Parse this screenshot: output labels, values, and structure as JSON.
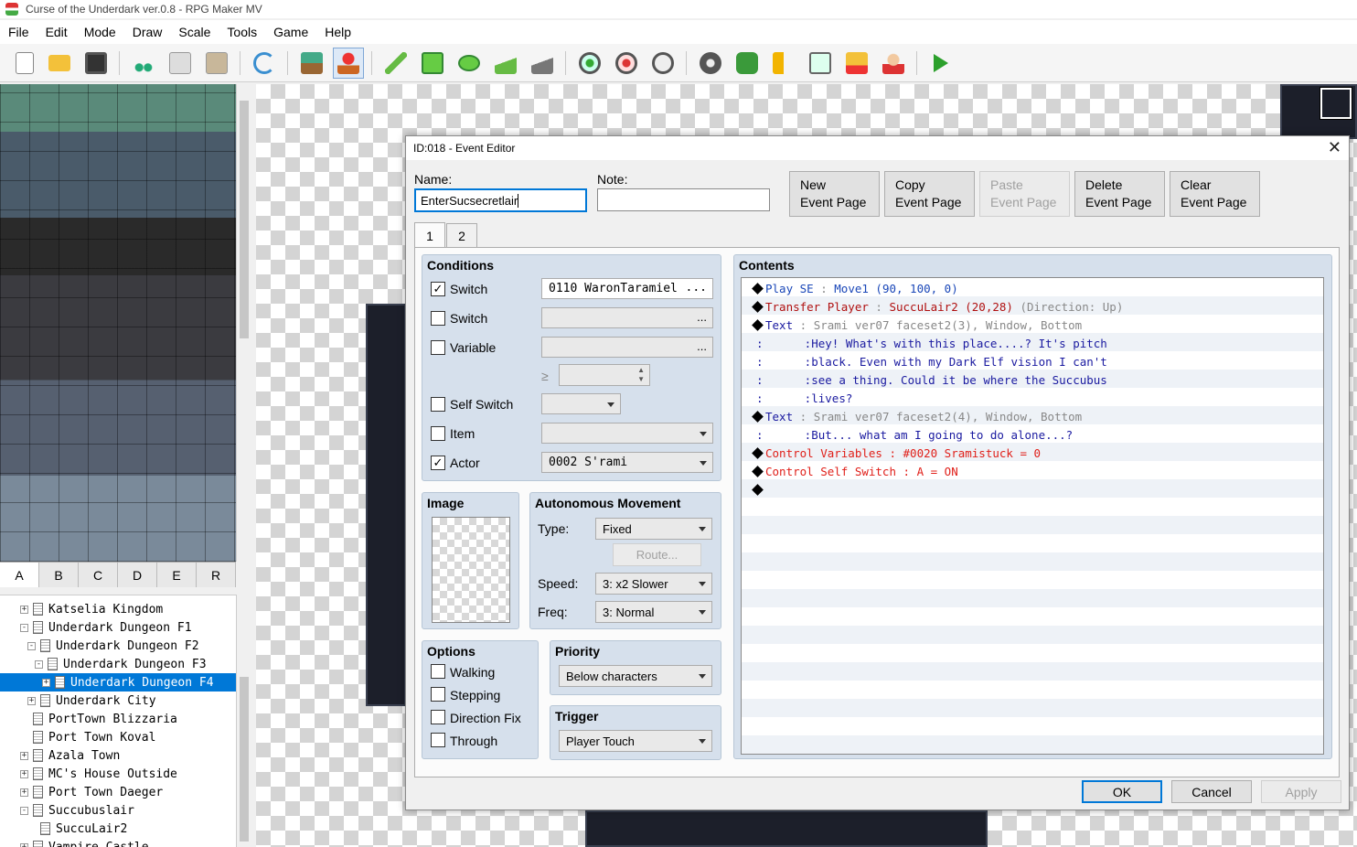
{
  "window": {
    "title": "Curse of the Underdark ver.0.8 - RPG Maker MV"
  },
  "menu": [
    "File",
    "Edit",
    "Mode",
    "Draw",
    "Scale",
    "Tools",
    "Game",
    "Help"
  ],
  "toolbar": {
    "icons": [
      "new-project-icon",
      "open-project-icon",
      "save-project-icon",
      "cut-icon",
      "copy-icon",
      "paste-icon",
      "undo-icon",
      "map-mode-icon",
      "event-mode-icon",
      "pencil-icon",
      "rectangle-icon",
      "ellipse-icon",
      "fill-icon",
      "shadow-pen-icon",
      "zoom-in-icon",
      "zoom-out-icon",
      "actual-size-icon",
      "database-icon",
      "plugin-manager-icon",
      "sound-test-icon",
      "event-searcher-icon",
      "resource-manager-icon",
      "character-generator-icon",
      "playtest-icon"
    ]
  },
  "tile_tabs": [
    "A",
    "B",
    "C",
    "D",
    "E",
    "R"
  ],
  "map_tree": [
    {
      "label": "Katselia Kingdom",
      "indent": 0,
      "exp": "+"
    },
    {
      "label": "Underdark Dungeon F1",
      "indent": 0,
      "exp": "-"
    },
    {
      "label": "Underdark Dungeon F2",
      "indent": 1,
      "exp": "-"
    },
    {
      "label": "Underdark Dungeon F3",
      "indent": 2,
      "exp": "-"
    },
    {
      "label": "Underdark Dungeon F4",
      "indent": 3,
      "exp": "+",
      "selected": true
    },
    {
      "label": "Underdark City",
      "indent": 1,
      "exp": "+"
    },
    {
      "label": "PortTown Blizzaria",
      "indent": 0,
      "exp": ""
    },
    {
      "label": "Port Town Koval",
      "indent": 0,
      "exp": ""
    },
    {
      "label": "Azala Town",
      "indent": 0,
      "exp": "+"
    },
    {
      "label": "MC's House Outside",
      "indent": 0,
      "exp": "+"
    },
    {
      "label": "Port Town Daeger",
      "indent": 0,
      "exp": "+"
    },
    {
      "label": "Succubuslair",
      "indent": 0,
      "exp": "-"
    },
    {
      "label": "SuccuLair2",
      "indent": 1,
      "exp": ""
    },
    {
      "label": "Vampire Castle",
      "indent": 0,
      "exp": "+"
    }
  ],
  "dialog": {
    "title": "ID:018 - Event Editor",
    "name_label": "Name:",
    "name_value": "EnterSucsecretlair",
    "note_label": "Note:",
    "note_value": "",
    "buttons": {
      "new_page": [
        "New",
        "Event Page"
      ],
      "copy_page": [
        "Copy",
        "Event Page"
      ],
      "paste_page": [
        "Paste",
        "Event Page"
      ],
      "delete_page": [
        "Delete",
        "Event Page"
      ],
      "clear_page": [
        "Clear",
        "Event Page"
      ]
    },
    "tabs": [
      "1",
      "2"
    ],
    "conditions": {
      "title": "Conditions",
      "switch1": {
        "label": "Switch",
        "checked": true,
        "value": "0110 WaronTaramiel"
      },
      "switch2": {
        "label": "Switch",
        "checked": false,
        "value": ""
      },
      "variable": {
        "label": "Variable",
        "checked": false,
        "value": ""
      },
      "gte": "≥",
      "self_switch": {
        "label": "Self Switch",
        "checked": false,
        "value": ""
      },
      "item": {
        "label": "Item",
        "checked": false,
        "value": ""
      },
      "actor": {
        "label": "Actor",
        "checked": true,
        "value": "0002 S'rami"
      },
      "more": "..."
    },
    "image": {
      "title": "Image"
    },
    "autonomous": {
      "title": "Autonomous Movement",
      "type_label": "Type:",
      "type_value": "Fixed",
      "route_label": "Route...",
      "speed_label": "Speed:",
      "speed_value": "3: x2 Slower",
      "freq_label": "Freq:",
      "freq_value": "3: Normal"
    },
    "options": {
      "title": "Options",
      "walking": "Walking",
      "stepping": "Stepping",
      "direction_fix": "Direction Fix",
      "through": "Through"
    },
    "priority": {
      "title": "Priority",
      "value": "Below characters"
    },
    "trigger": {
      "title": "Trigger",
      "value": "Player Touch"
    },
    "contents": {
      "title": "Contents",
      "lines": [
        {
          "diamond": true,
          "parts": [
            [
              "Play SE",
              "c-blue"
            ],
            [
              " : ",
              "c-grey"
            ],
            [
              "Move1 (90, 100, 0)",
              "c-blue"
            ]
          ]
        },
        {
          "diamond": true,
          "parts": [
            [
              "Transfer Player",
              "c-dred"
            ],
            [
              " : ",
              "c-grey"
            ],
            [
              "SuccuLair2 (20,28)",
              "c-dred"
            ],
            [
              " (Direction: Up)",
              "c-grey"
            ]
          ]
        },
        {
          "diamond": true,
          "parts": [
            [
              "Text",
              "c-navy"
            ],
            [
              " : ",
              "c-grey"
            ],
            [
              "Srami ver07 faceset2(3), Window, Bottom",
              "c-grey"
            ]
          ]
        },
        {
          "diamond": false,
          "parts": [
            [
              ":      :",
              "c-navy"
            ],
            [
              "Hey! What's with this place....? It's pitch",
              "c-navy"
            ]
          ]
        },
        {
          "diamond": false,
          "parts": [
            [
              ":      :",
              "c-navy"
            ],
            [
              "black. Even with my Dark Elf vision I can't",
              "c-navy"
            ]
          ]
        },
        {
          "diamond": false,
          "parts": [
            [
              ":      :",
              "c-navy"
            ],
            [
              "see a thing. Could it be where the Succubus",
              "c-navy"
            ]
          ]
        },
        {
          "diamond": false,
          "parts": [
            [
              ":      :",
              "c-navy"
            ],
            [
              "lives?",
              "c-navy"
            ]
          ]
        },
        {
          "diamond": true,
          "parts": [
            [
              "Text",
              "c-navy"
            ],
            [
              " : ",
              "c-grey"
            ],
            [
              "Srami ver07 faceset2(4), Window, Bottom",
              "c-grey"
            ]
          ]
        },
        {
          "diamond": false,
          "parts": [
            [
              ":      :",
              "c-navy"
            ],
            [
              "But... what am I going to do alone...?",
              "c-navy"
            ]
          ]
        },
        {
          "diamond": true,
          "parts": [
            [
              "Control Variables",
              "c-red"
            ],
            [
              " : ",
              "c-red"
            ],
            [
              "#0020 Sramistuck = 0",
              "c-red"
            ]
          ]
        },
        {
          "diamond": true,
          "parts": [
            [
              "Control Self Switch",
              "c-red"
            ],
            [
              " : ",
              "c-red"
            ],
            [
              "A = ON",
              "c-red"
            ]
          ]
        },
        {
          "diamond": true,
          "parts": []
        }
      ]
    },
    "footer": {
      "ok": "OK",
      "cancel": "Cancel",
      "apply": "Apply"
    }
  }
}
